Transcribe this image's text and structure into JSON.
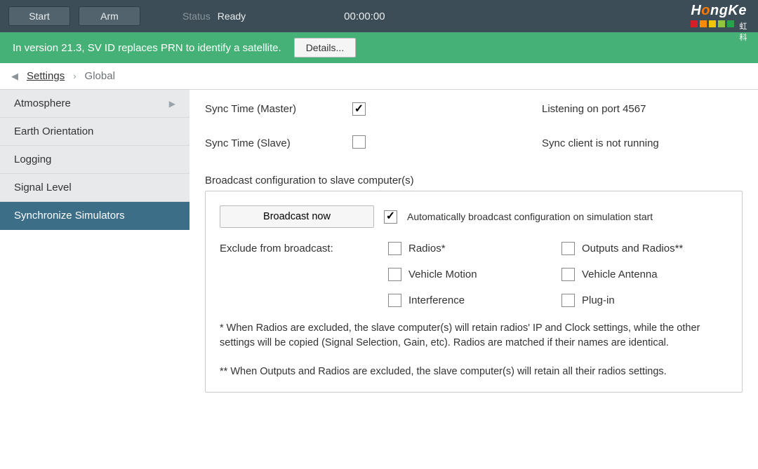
{
  "topbar": {
    "start_label": "Start",
    "arm_label": "Arm",
    "status_label": "Status",
    "status_value": "Ready",
    "timer": "00:00:00"
  },
  "logo": {
    "wordmark_pre": "H",
    "wordmark_o": "o",
    "wordmark_post": "ngKe",
    "sub": "虹科",
    "colors": [
      "#d61f26",
      "#ff8a00",
      "#f3c400",
      "#90c53e",
      "#2aa24a"
    ]
  },
  "notice": {
    "text": "In version 21.3, SV ID replaces PRN to identify a satellite.",
    "details_label": "Details..."
  },
  "breadcrumb": {
    "back_glyph": "◀",
    "sep_glyph": "›",
    "items": [
      {
        "label": "Settings",
        "link": true
      },
      {
        "label": "Global",
        "link": false
      }
    ]
  },
  "sidebar": {
    "items": [
      {
        "label": "Atmosphere",
        "has_children": true,
        "active": false
      },
      {
        "label": "Earth Orientation",
        "has_children": false,
        "active": false
      },
      {
        "label": "Logging",
        "has_children": false,
        "active": false
      },
      {
        "label": "Signal Level",
        "has_children": false,
        "active": false
      },
      {
        "label": "Synchronize Simulators",
        "has_children": false,
        "active": true
      }
    ]
  },
  "content": {
    "sync_master_label": "Sync Time (Master)",
    "sync_master_checked": true,
    "sync_master_status": "Listening on port 4567",
    "sync_slave_label": "Sync Time (Slave)",
    "sync_slave_checked": false,
    "sync_slave_status": "Sync client is not running",
    "broadcast_section_title": "Broadcast configuration to slave computer(s)",
    "broadcast_button": "Broadcast now",
    "auto_broadcast_label": "Automatically broadcast configuration on simulation start",
    "auto_broadcast_checked": true,
    "exclude_label": "Exclude from broadcast:",
    "excludes": [
      {
        "label": "Radios*",
        "checked": false
      },
      {
        "label": "Outputs and Radios**",
        "checked": false
      },
      {
        "label": "Vehicle Motion",
        "checked": false
      },
      {
        "label": "Vehicle Antenna",
        "checked": false
      },
      {
        "label": "Interference",
        "checked": false
      },
      {
        "label": "Plug-in",
        "checked": false
      }
    ],
    "footnote1": "* When Radios are excluded, the slave computer(s) will retain radios' IP and Clock settings, while the other settings will be copied (Signal Selection, Gain, etc). Radios are matched if their names are identical.",
    "footnote2": "** When Outputs and Radios are excluded, the slave computer(s) will retain all their radios settings."
  }
}
